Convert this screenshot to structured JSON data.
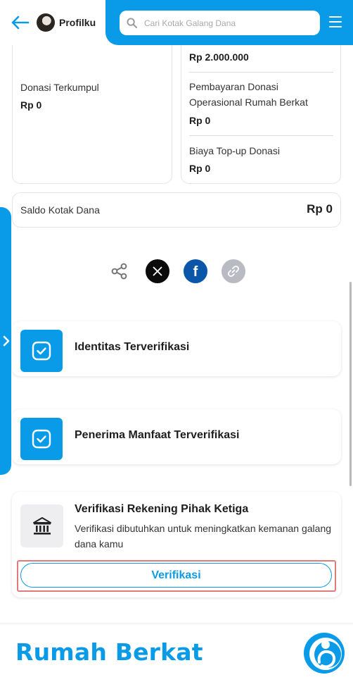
{
  "header": {
    "profile_label": "Profilku",
    "search_placeholder": "Cari Kotak Galang Dana"
  },
  "summary": {
    "left": {
      "label": "Donasi Terkumpul",
      "value": "Rp 0"
    },
    "right": [
      {
        "label": "",
        "value": "Rp 2.000.000"
      },
      {
        "label": "Pembayaran Donasi Operasional Rumah Berkat",
        "value": "Rp 0"
      },
      {
        "label": "Biaya Top-up Donasi",
        "value": "Rp 0"
      }
    ]
  },
  "saldo": {
    "label": "Saldo Kotak Dana",
    "value": "Rp 0"
  },
  "share": [
    "share-icon",
    "x-icon",
    "facebook-icon",
    "link-icon"
  ],
  "verifications": [
    {
      "title": "Identitas Terverifikasi"
    },
    {
      "title": "Penerima Manfaat Terverifikasi"
    }
  ],
  "third_party": {
    "title": "Verifikasi Rekening Pihak Ketiga",
    "description": "Verifikasi dibutuhkan untuk meningkatkan kemanan galang dana kamu",
    "button_label": "Verifikasi"
  },
  "footer": {
    "brand": "Rumah Berkat"
  },
  "colors": {
    "primary": "#0a9be8",
    "highlight": "#e07b7b"
  }
}
